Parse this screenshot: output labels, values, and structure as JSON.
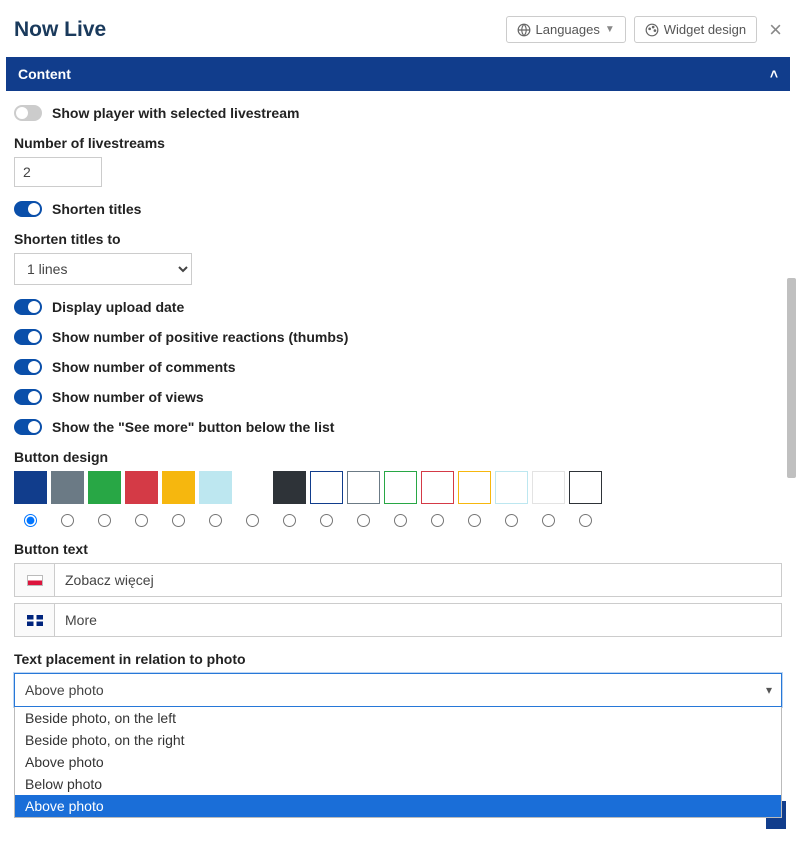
{
  "header": {
    "title": "Now Live",
    "languages_btn": "Languages",
    "widget_design_btn": "Widget design"
  },
  "section": {
    "title": "Content"
  },
  "toggles": {
    "show_player": {
      "label": "Show player with selected livestream",
      "on": false
    },
    "shorten_titles": {
      "label": "Shorten titles",
      "on": true
    },
    "display_upload_date": {
      "label": "Display upload date",
      "on": true
    },
    "show_reactions": {
      "label": "Show number of positive reactions (thumbs)",
      "on": true
    },
    "show_comments": {
      "label": "Show number of comments",
      "on": true
    },
    "show_views": {
      "label": "Show number of views",
      "on": true
    },
    "show_see_more": {
      "label": "Show the \"See more\" button below the list",
      "on": true
    }
  },
  "fields": {
    "num_livestreams": {
      "label": "Number of livestreams",
      "value": "2"
    },
    "shorten_to": {
      "label": "Shorten titles to",
      "value": "1 lines"
    },
    "button_design": {
      "label": "Button design"
    },
    "button_text": {
      "label": "Button text"
    },
    "text_placement": {
      "label": "Text placement in relation to photo"
    }
  },
  "button_design": {
    "selected": 0,
    "swatches": [
      {
        "bg": "#113D8C",
        "border": ""
      },
      {
        "bg": "#6b7a85",
        "border": ""
      },
      {
        "bg": "#28a745",
        "border": ""
      },
      {
        "bg": "#d43a46",
        "border": ""
      },
      {
        "bg": "#f6b70e",
        "border": ""
      },
      {
        "bg": "#bde7f0",
        "border": ""
      },
      {
        "bg": "#ffffff",
        "border": ""
      },
      {
        "bg": "#2e3338",
        "border": ""
      },
      {
        "bg": "#ffffff",
        "border": "#113D8C"
      },
      {
        "bg": "#ffffff",
        "border": "#6b7a85"
      },
      {
        "bg": "#ffffff",
        "border": "#28a745"
      },
      {
        "bg": "#ffffff",
        "border": "#d43a46"
      },
      {
        "bg": "#ffffff",
        "border": "#f6b70e"
      },
      {
        "bg": "#ffffff",
        "border": "#bde7f0"
      },
      {
        "bg": "#ffffff",
        "border": "#e3e3e3"
      },
      {
        "bg": "#ffffff",
        "border": "#2e3338"
      }
    ]
  },
  "button_text": {
    "rows": [
      {
        "flag": "pl",
        "value": "Zobacz więcej"
      },
      {
        "flag": "gb",
        "value": "More"
      }
    ]
  },
  "text_placement": {
    "selected": "Above photo",
    "options": [
      "Beside photo, on the left",
      "Beside photo, on the right",
      "Above photo",
      "Below photo",
      "Above photo"
    ],
    "highlighted_index": 4
  }
}
